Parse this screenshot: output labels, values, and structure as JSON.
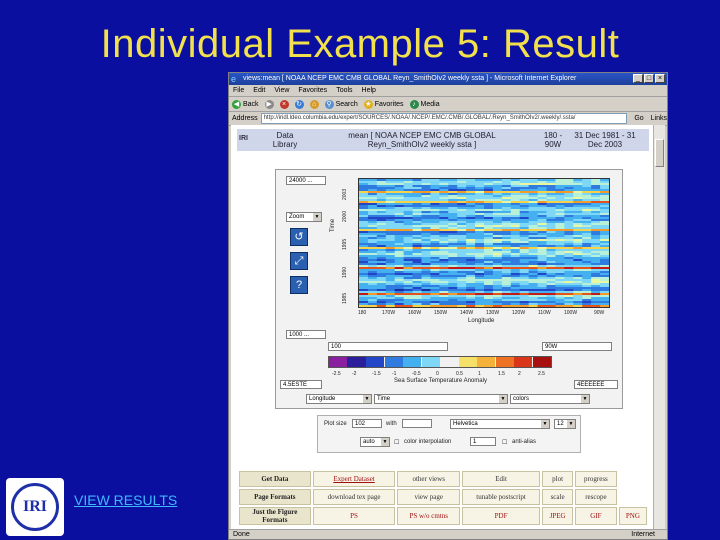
{
  "slide": {
    "title": "Individual Example 5: Result",
    "view_results": "VIEW RESULTS",
    "logo_text": "IRI"
  },
  "browser": {
    "title": "views:mean [ NOAA NCEP EMC CMB GLOBAL Reyn_SmithOIv2 weekly ssta ] - Microsoft Internet Explorer",
    "menu": [
      "File",
      "Edit",
      "View",
      "Favorites",
      "Tools",
      "Help"
    ],
    "toolbar": {
      "back": "Back",
      "search": "Search",
      "favorites": "Favorites",
      "media": "Media"
    },
    "address_label": "Address",
    "address_value": "http://iridl.ldeo.columbia.edu/expert/SOURCES/.NOAA/.NCEP/.EMC/.CMB/.GLOBAL/.Reyn_SmithOIv2/.weekly/.ssta/",
    "go": "Go",
    "links": "Links",
    "status_left": "Done",
    "status_right": "Internet"
  },
  "page_header": {
    "iri": "IRI",
    "data_library": "Data\nLibrary",
    "dataset": "mean [ NOAA NCEP EMC CMB GLOBAL\nReyn_SmithOIv2 weekly ssta ]",
    "range": "180 -\n90W",
    "dates": "31 Dec 1981 - 31\nDec 2003"
  },
  "plot_panel": {
    "top_field": "24000 ...",
    "bottom_field": "1000 ...",
    "zoom": "Zoom",
    "left_field": "100",
    "right_field": "90W",
    "x_axis_label": "Longitude",
    "y_axis_label": "Time",
    "x_ticks": [
      "180",
      "170W",
      "160W",
      "150W",
      "140W",
      "130W",
      "120W",
      "110W",
      "100W",
      "90W"
    ],
    "y_ticks": [
      "2003",
      "2000",
      "1995",
      "1990",
      "1985"
    ],
    "colorbar_label": "Sea Surface Temperature Anomaly",
    "colorbar_ticks": [
      "-2.5",
      "-2",
      "-1.5",
      "-1",
      "-0.5",
      "0",
      "0.5",
      "1",
      "1.5",
      "2",
      "2.5"
    ],
    "colorbar_left": "4.5ESTE",
    "colorbar_right": "4EEEEEE",
    "select_x": "Longitude",
    "select_y": "Time",
    "select_color": "colors"
  },
  "options": {
    "plot_size_label": "Plot size",
    "plot_size": "102",
    "with_label": "with",
    "with_value": "",
    "font_label": "Helvetica",
    "font_value": "Helvetica",
    "font_size": "12",
    "auto_label": "auto",
    "interpolation_label": "color interpolation",
    "interpolation_value": "1",
    "antialias_label": "anti-alias"
  },
  "links_table": {
    "rows": [
      {
        "head": "Get Data",
        "cells": [
          "Expert Dataset",
          "other views",
          "Edit",
          "plot",
          "progress"
        ]
      },
      {
        "head": "Page Formats",
        "cells": [
          "download tex page",
          "view page",
          "tunable postscript",
          "scale",
          "rescope"
        ]
      },
      {
        "head": "Just the Figure\nFormats",
        "cells": [
          "PS",
          "PS w/o cmtns",
          "PDF",
          "JPEG",
          "GIF",
          "PNG"
        ]
      }
    ]
  }
}
